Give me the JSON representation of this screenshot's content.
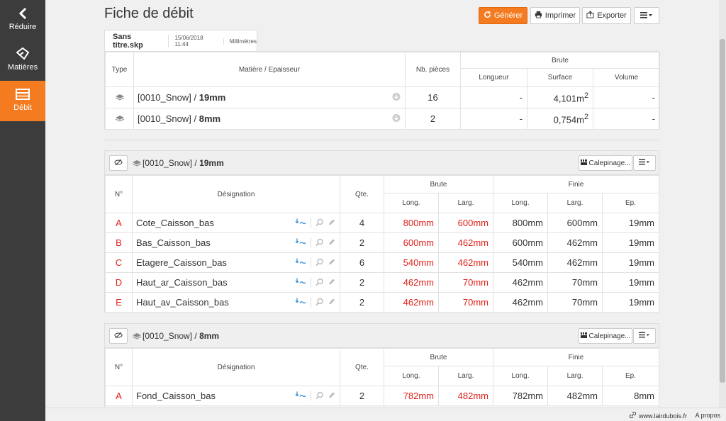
{
  "sidebar": {
    "items": [
      {
        "label": "Réduire",
        "icon": "chevron-left-icon"
      },
      {
        "label": "Matières",
        "icon": "tag-icon"
      },
      {
        "label": "Débit",
        "icon": "table-icon"
      }
    ]
  },
  "page": {
    "title": "Fiche de débit"
  },
  "toolbar": {
    "generate": "Générer",
    "print": "Imprimer",
    "export": "Exporter"
  },
  "tab": {
    "filename": "Sans titre.skp",
    "date": "15/06/2018 11:44",
    "unit": "Millimètres"
  },
  "summary": {
    "headers": {
      "type": "Type",
      "material": "Matière / Epaisseur",
      "pieces": "Nb. pièces",
      "raw": "Brute",
      "length": "Longueur",
      "surface": "Surface",
      "volume": "Volume"
    },
    "rows": [
      {
        "material": "[0010_Snow] / ",
        "thickness": "19mm",
        "pieces": "16",
        "length": "-",
        "surface": "4,101m",
        "sup": "2",
        "volume": "-"
      },
      {
        "material": "[0010_Snow] / ",
        "thickness": "8mm",
        "pieces": "2",
        "length": "-",
        "surface": "0,754m",
        "sup": "2",
        "volume": "-"
      }
    ]
  },
  "groups": [
    {
      "title": "[0010_Snow] / ",
      "thickness": "19mm",
      "layout_button": "Calepinage...",
      "headers": {
        "no": "N°",
        "designation": "Désignation",
        "qty": "Qte.",
        "raw": "Brute",
        "finished": "Finie",
        "long": "Long.",
        "larg": "Larg.",
        "ep": "Ep."
      },
      "rows": [
        {
          "id": "A",
          "name": "Cote_Caisson_bas",
          "qty": "4",
          "raw_long": "800mm",
          "raw_larg": "600mm",
          "fin_long": "800mm",
          "fin_larg": "600mm",
          "ep": "19mm"
        },
        {
          "id": "B",
          "name": "Bas_Caisson_bas",
          "qty": "2",
          "raw_long": "600mm",
          "raw_larg": "462mm",
          "fin_long": "600mm",
          "fin_larg": "462mm",
          "ep": "19mm"
        },
        {
          "id": "C",
          "name": "Etagere_Caisson_bas",
          "qty": "6",
          "raw_long": "540mm",
          "raw_larg": "462mm",
          "fin_long": "540mm",
          "fin_larg": "462mm",
          "ep": "19mm"
        },
        {
          "id": "D",
          "name": "Haut_ar_Caisson_bas",
          "qty": "2",
          "raw_long": "462mm",
          "raw_larg": "70mm",
          "fin_long": "462mm",
          "fin_larg": "70mm",
          "ep": "19mm"
        },
        {
          "id": "E",
          "name": "Haut_av_Caisson_bas",
          "qty": "2",
          "raw_long": "462mm",
          "raw_larg": "70mm",
          "fin_long": "462mm",
          "fin_larg": "70mm",
          "ep": "19mm"
        }
      ]
    },
    {
      "title": "[0010_Snow] / ",
      "thickness": "8mm",
      "layout_button": "Calepinage...",
      "headers": {
        "no": "N°",
        "designation": "Désignation",
        "qty": "Qte.",
        "raw": "Brute",
        "finished": "Finie",
        "long": "Long.",
        "larg": "Larg.",
        "ep": "Ep."
      },
      "rows": [
        {
          "id": "A",
          "name": "Fond_Caisson_bas",
          "qty": "2",
          "raw_long": "782mm",
          "raw_larg": "482mm",
          "fin_long": "782mm",
          "fin_larg": "482mm",
          "ep": "8mm"
        }
      ]
    }
  ],
  "footer": {
    "link": "www.lairdubois.fr",
    "about": "A propos"
  },
  "colors": {
    "accent": "#f47b20",
    "sidebar": "#3c3c3c",
    "red": "#e0211b"
  }
}
